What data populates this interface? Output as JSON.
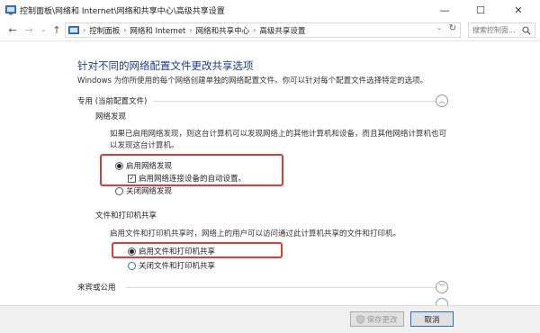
{
  "window": {
    "title": "控制面板\\网络和 Internet\\网络和共享中心\\高级共享设置",
    "min_glyph": "—",
    "max_glyph": "☐",
    "close_glyph": "✕"
  },
  "nav": {
    "back_glyph": "←",
    "forward_glyph": "→",
    "dropdown_glyph": "⌄",
    "up_glyph": "↑",
    "refresh_glyph": "↻",
    "breadcrumbs": [
      "控制面板",
      "网络和 Internet",
      "网络和共享中心",
      "高级共享设置"
    ],
    "search_placeholder": "搜索控制面..."
  },
  "page": {
    "title": "针对不同的网络配置文件更改共享选项",
    "description": "Windows 为你所使用的每个网络创建单独的网络配置文件。你可以针对每个配置文件选择特定的选项。"
  },
  "profiles": {
    "private": {
      "label": "专用 (当前配置文件)",
      "collapse_glyph": "︿"
    },
    "guest": {
      "label": "来宾或公用",
      "expand_glyph": "﹀"
    }
  },
  "network_discovery": {
    "label": "网络发现",
    "description": "如果已启用网络发现，则这台计算机可以发现网络上的其他计算机和设备，而且其他网络计算机也可以发现这台计算机。",
    "option_on": "启用网络发现",
    "auto_setup": "启用网络连接设备的自动设置。",
    "option_off": "关闭网络发现",
    "selected": "on",
    "auto_setup_checked": true
  },
  "file_printer_sharing": {
    "label": "文件和打印机共享",
    "description": "启用文件和打印机共享时，网络上的用户可以访问通过此计算机共享的文件和打印机。",
    "option_on": "启用文件和打印机共享",
    "option_off": "关闭文件和打印机共享",
    "selected": "on"
  },
  "footer": {
    "save_label": "保存更改",
    "cancel_label": "取消"
  },
  "colors": {
    "title_blue": "#1e3c8c",
    "highlight_red": "#e03b3b",
    "focus_blue": "#1e73c8"
  }
}
